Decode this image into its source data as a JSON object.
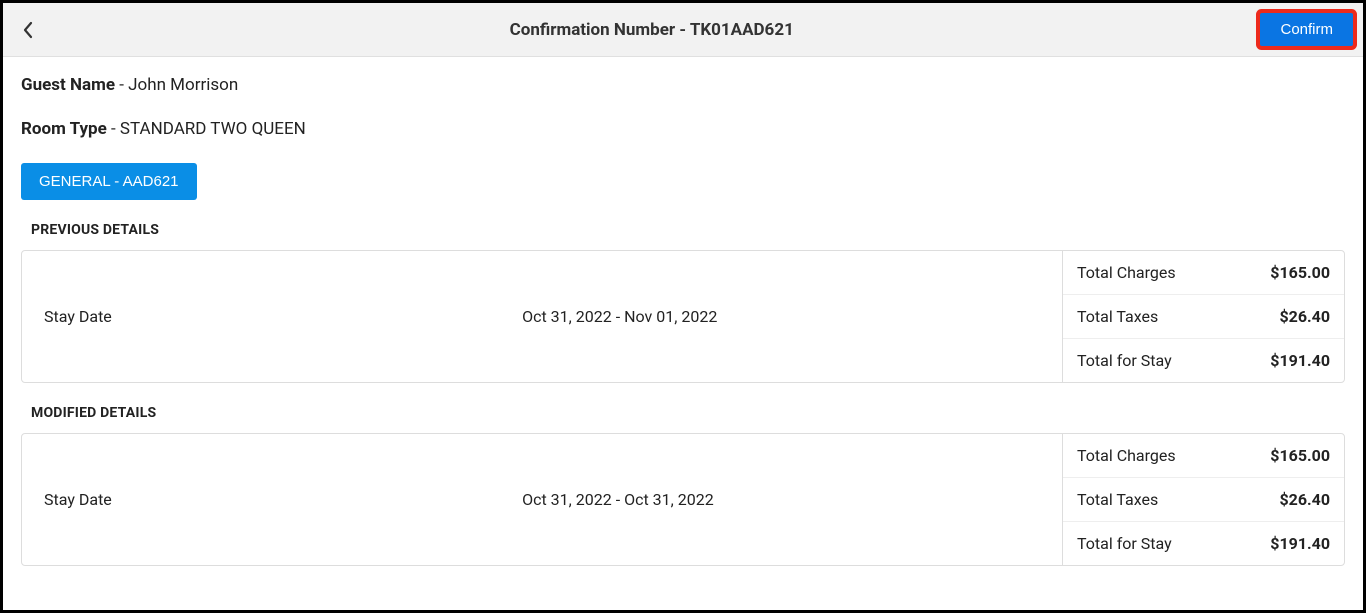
{
  "header": {
    "title": "Confirmation Number - TK01AAD621",
    "confirm_label": "Confirm"
  },
  "guest": {
    "name_label": "Guest Name",
    "name_separator": "  - ",
    "name_value": "John Morrison",
    "room_type_label": "Room Type",
    "room_type_separator": "  - ",
    "room_type_value": "STANDARD TWO QUEEN"
  },
  "tab": {
    "label": "GENERAL - AAD621"
  },
  "previous": {
    "section_title": "PREVIOUS DETAILS",
    "stay_date_label": "Stay Date",
    "stay_date_value": "Oct 31, 2022 - Nov 01, 2022",
    "totals": {
      "charges_label": "Total Charges",
      "charges_value": "$165.00",
      "taxes_label": "Total Taxes",
      "taxes_value": "$26.40",
      "stay_label": "Total for Stay",
      "stay_value": "$191.40"
    }
  },
  "modified": {
    "section_title": "MODIFIED DETAILS",
    "stay_date_label": "Stay Date",
    "stay_date_value": "Oct 31, 2022 - Oct 31, 2022",
    "totals": {
      "charges_label": "Total Charges",
      "charges_value": "$165.00",
      "taxes_label": "Total Taxes",
      "taxes_value": "$26.40",
      "stay_label": "Total for Stay",
      "stay_value": "$191.40"
    }
  }
}
